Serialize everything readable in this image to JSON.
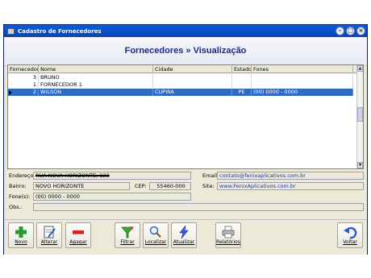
{
  "window": {
    "title": "Cadastro de Fornecedores",
    "buttons": [
      "-",
      "□",
      "×"
    ]
  },
  "header": {
    "title": "Fornecedores » Visualização"
  },
  "grid": {
    "columns": [
      "Fornecedor",
      "Nome",
      "Cidade",
      "Estado",
      "Fones"
    ],
    "rows": [
      {
        "id": "3",
        "nome": "BRUNO",
        "cidade": "",
        "estado": "",
        "fones": ""
      },
      {
        "id": "1",
        "nome": "FORNECEDOR 1",
        "cidade": "",
        "estado": "",
        "fones": ""
      },
      {
        "id": "2",
        "nome": "WILSON",
        "cidade": "CUPIRA",
        "estado": "PE",
        "fones": "(00) 0000 - 0000"
      }
    ],
    "selected_row": 2
  },
  "details": {
    "endereco_label": "Endereço:",
    "endereco": "RUA NOVA HORIZONTE, 123",
    "bairro_label": "Bairro:",
    "bairro": "NOVO HORIZONTE",
    "cep_label": "CEP:",
    "cep": "55460-000",
    "fones_label": "Fone(s):",
    "fones": "(00) 0000 - 0000",
    "obs_label": "Obs.:",
    "obs": "",
    "email_label": "Email:",
    "email": "contato@fenixaplicativos.com.br",
    "site_label": "Site:",
    "site": "www.FenixAplicativos.com.br"
  },
  "toolbar": {
    "novo": "Novo",
    "alterar": "Alterar",
    "apagar": "Apagar",
    "filtrar": "Filtrar",
    "localizar": "Localizar",
    "atualizar": "Atualizar",
    "relatorios": "Relatórios",
    "voltar": "Voltar"
  },
  "colors": {
    "title_bar": "#0a5bd8",
    "header_text": "#1a2a8a",
    "selection": "#316ac5"
  }
}
